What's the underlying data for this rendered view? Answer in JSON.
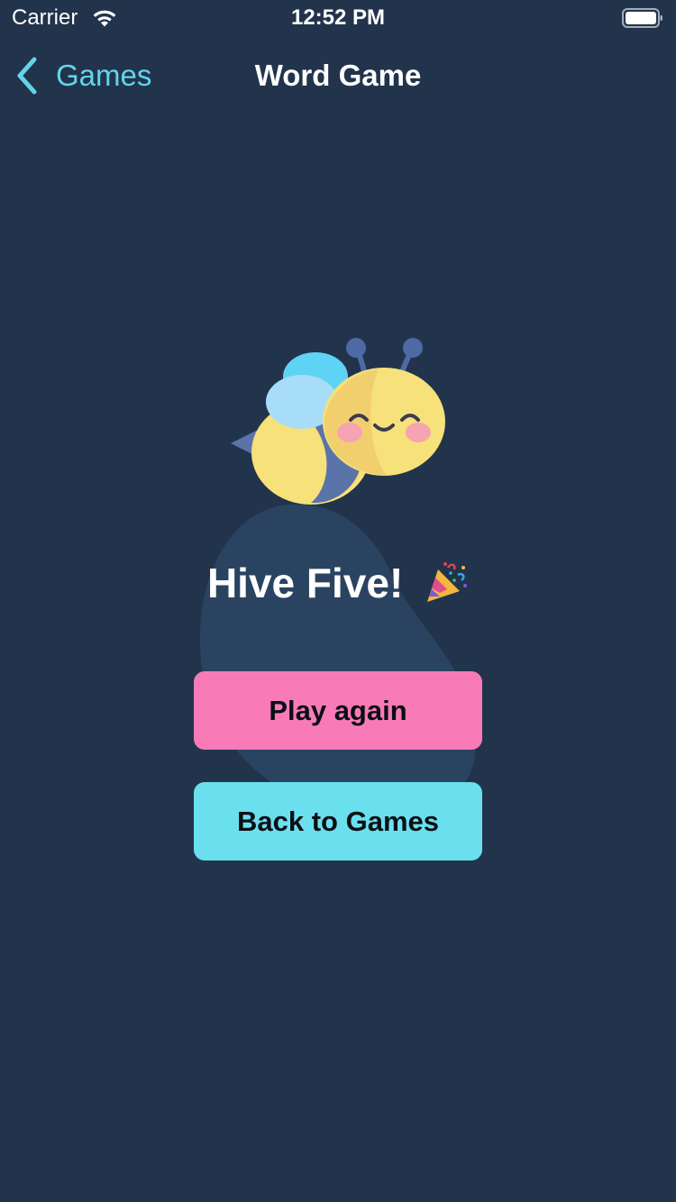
{
  "status_bar": {
    "carrier": "Carrier",
    "time": "12:52 PM",
    "wifi_icon": "wifi-icon",
    "battery_icon": "battery-icon"
  },
  "nav": {
    "back_label": "Games",
    "title": "Word Game",
    "back_icon": "chevron-left-icon"
  },
  "result": {
    "title": "Hive Five!",
    "emoji_icon": "party-popper-icon",
    "illustration": "bee-illustration"
  },
  "buttons": {
    "play_again": "Play again",
    "back_to_games": "Back to Games"
  },
  "colors": {
    "background": "#21344b",
    "accent": "#63d4ea",
    "play_button": "#f87bb7",
    "back_button": "#6ae0ef"
  }
}
